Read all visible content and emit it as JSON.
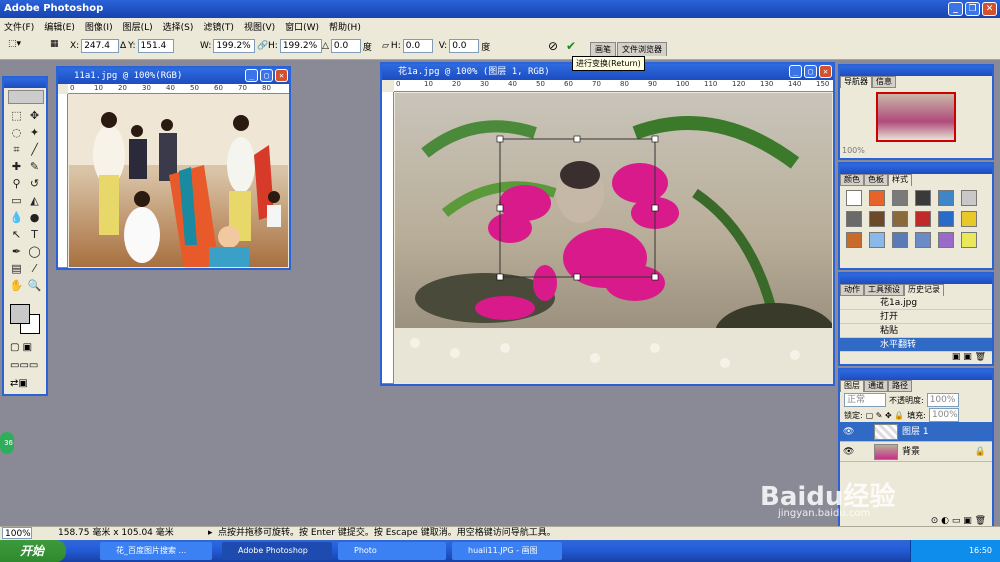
{
  "app": {
    "title": "Adobe Photoshop"
  },
  "menu": [
    "文件(F)",
    "编辑(E)",
    "图像(I)",
    "图层(L)",
    "选择(S)",
    "滤镜(T)",
    "视图(V)",
    "窗口(W)",
    "帮助(H)"
  ],
  "options": {
    "x_label": "X:",
    "x_value": "247.4",
    "y_label": "Y:",
    "y_value": "151.4",
    "w_label": "W:",
    "w_value": "199.2%",
    "h_label": "H:",
    "h_value": "199.2%",
    "angle_value": "0.0",
    "angle_unit": "度",
    "skew_h_label": "H:",
    "skew_h_value": "0.0",
    "skew_v_label": "V:",
    "skew_v_value": "0.0",
    "skew_unit": "度",
    "tabs": [
      "画笔",
      "文件浏览器"
    ],
    "commit_tooltip": "进行变换(Return)"
  },
  "doc1": {
    "title": "11a1.jpg @ 100%(RGB)"
  },
  "doc2": {
    "title": "花1a.jpg @ 100% (图层 1, RGB)"
  },
  "ruler_ticks_doc1": [
    "0",
    "10",
    "20",
    "30",
    "40",
    "50",
    "60",
    "70",
    "80"
  ],
  "ruler_ticks_doc2": [
    "0",
    "10",
    "20",
    "30",
    "40",
    "50",
    "60",
    "70",
    "80",
    "90",
    "100",
    "110",
    "120",
    "130",
    "140",
    "150"
  ],
  "navigator": {
    "tabs": [
      "导航器",
      "信息"
    ],
    "zoom": "100%"
  },
  "styles": {
    "tabs": [
      "颜色",
      "色板",
      "样式"
    ],
    "colors": [
      "#ffffff",
      "#e8632a",
      "#7a7a7a",
      "#3a3a3a",
      "#3f86c8",
      "#c8c8c8",
      "#6a6a6a",
      "#6b4a2a",
      "#8a6a3a",
      "#c02a2a",
      "#2a6ac8",
      "#e8c82a",
      "#c86a2a",
      "#8ab8e8",
      "#5a7ab8",
      "#6a8ac8",
      "#9a6ac8",
      "#e8e85a"
    ]
  },
  "history": {
    "tabs": [
      "动作",
      "工具预设",
      "历史记录"
    ],
    "items": [
      "花1a.jpg",
      "打开",
      "粘贴",
      "水平翻转"
    ]
  },
  "layers": {
    "tabs": [
      "图层",
      "通道",
      "路径"
    ],
    "blend_mode": "正常",
    "opacity_label": "不透明度:",
    "opacity_value": "100%",
    "lock_label": "锁定:",
    "fill_label": "填充:",
    "fill_value": "100%",
    "items": [
      "图层 1",
      "背景"
    ]
  },
  "status": {
    "zoom": "100%",
    "size": "158.75 毫米 x 105.04 毫米",
    "hint": "点按并拖移可旋转。按 Enter 键提交。按 Escape 键取消。用空格键访问导航工具。"
  },
  "taskbar": {
    "start": "开始",
    "tasks": [
      "花_百度图片搜索 ...",
      "Adobe Photoshop",
      "Photo",
      "huali11.JPG - 画图"
    ],
    "clock": "16:50"
  },
  "watermark": {
    "brand": "Baidu经验",
    "url": "jingyan.baidu.com"
  },
  "badge": "36"
}
